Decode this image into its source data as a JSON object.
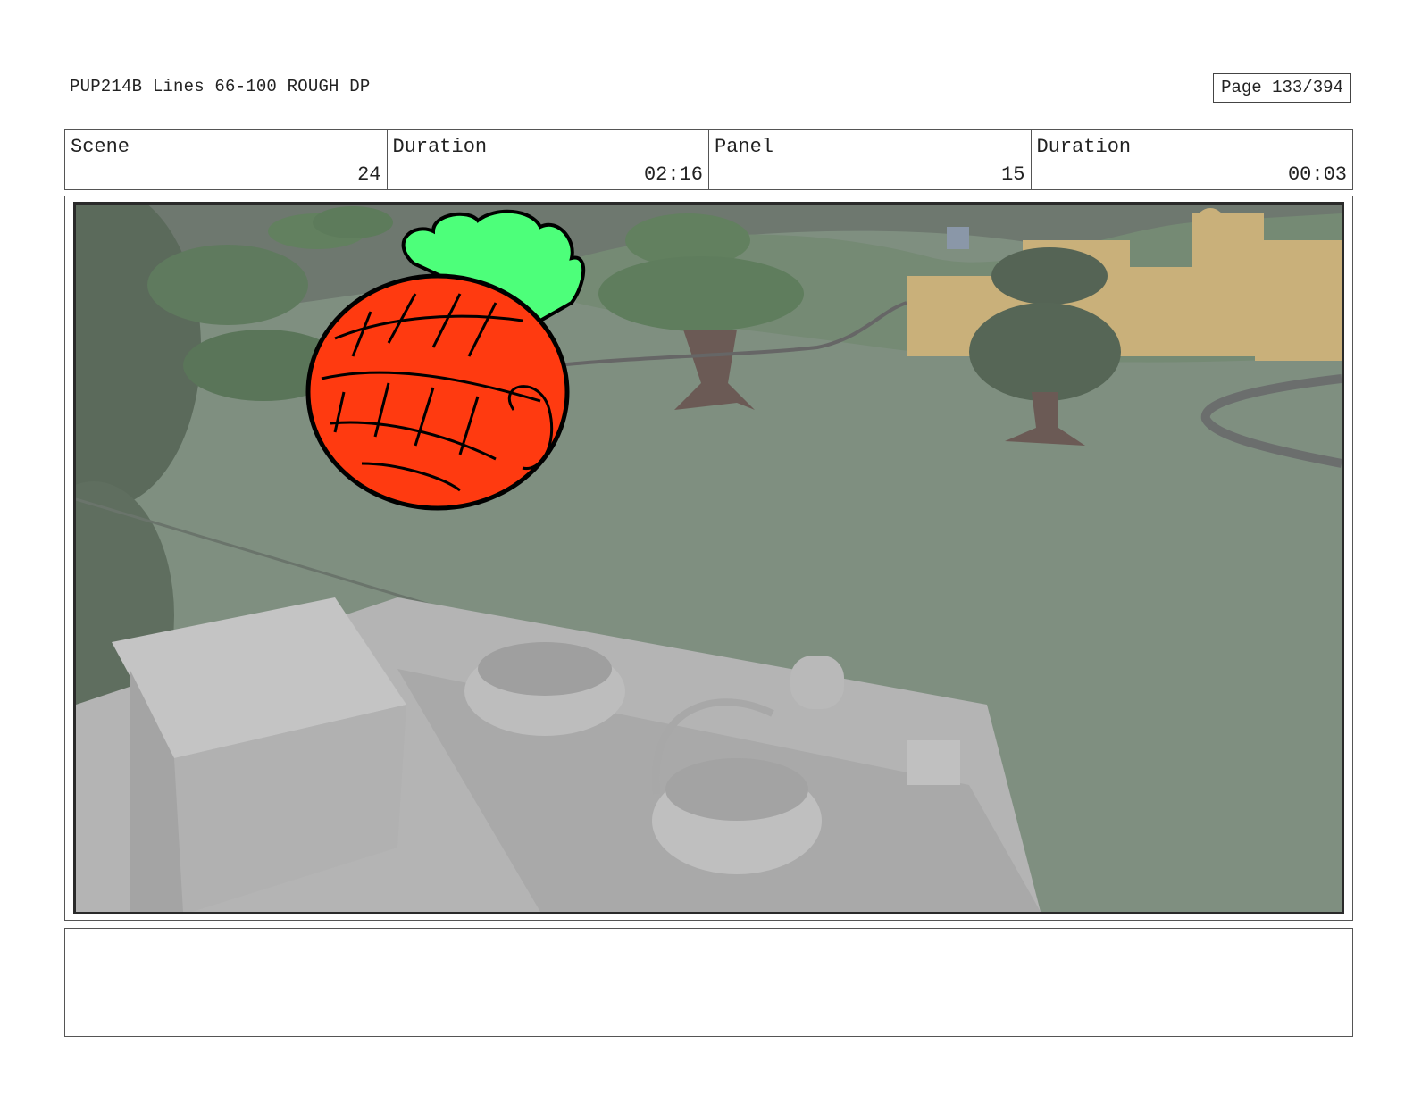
{
  "document": {
    "title": "PUP214B Lines 66-100 ROUGH DP",
    "page": "Page 133/394"
  },
  "info": {
    "scene_label": "Scene",
    "scene_value": "24",
    "scene_duration_label": "Duration",
    "scene_duration_value": "02:16",
    "panel_label": "Panel",
    "panel_value": "15",
    "panel_duration_label": "Duration",
    "panel_duration_value": "00:03"
  },
  "colors": {
    "ground": "#7f8f80",
    "sky": "#6f776f",
    "foliage": "#5f7a5e",
    "buildings": "#c9b07a",
    "props": "#b8b8b8",
    "pineapple": "#ff3a10",
    "leaves": "#4dff7a"
  },
  "notes": {
    "text": ""
  }
}
